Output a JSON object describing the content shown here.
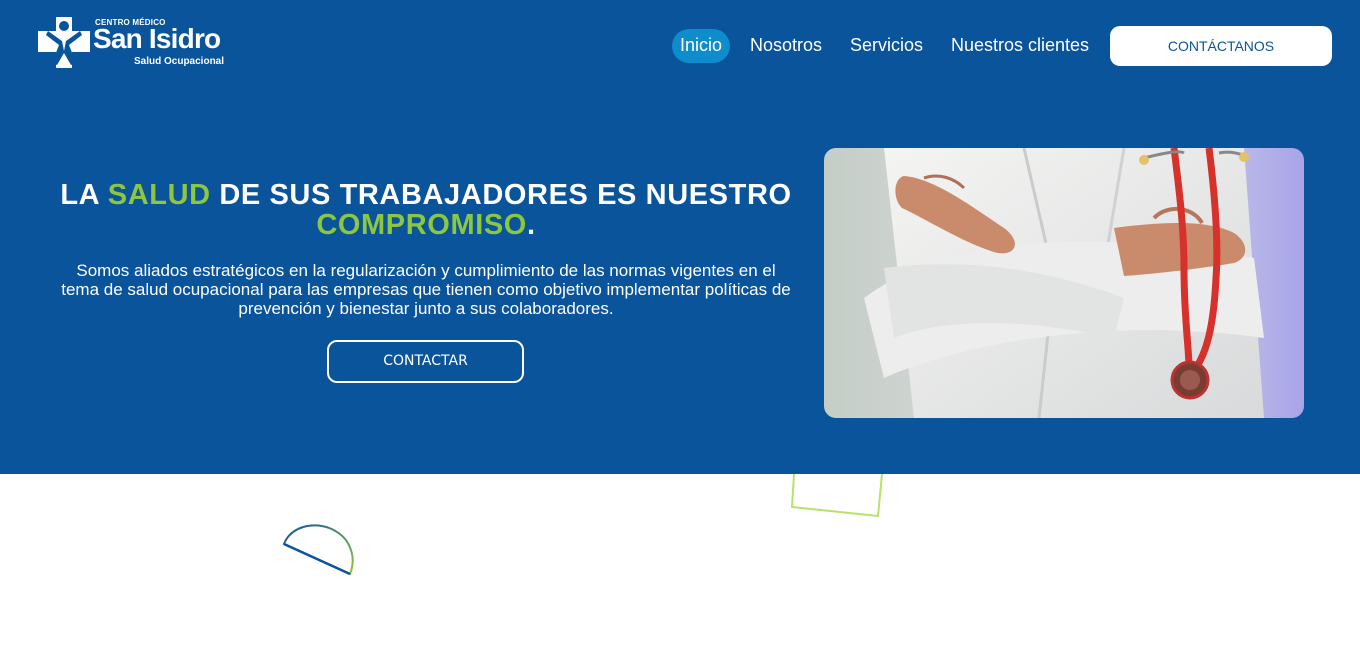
{
  "brand": {
    "top_line": "CENTRO MÉDICO",
    "name": "San Isidro",
    "tagline": "Salud Ocupacional",
    "logo_icon": "medical-cross-person-logo"
  },
  "nav": {
    "items": [
      {
        "label": "Inicio",
        "active": true
      },
      {
        "label": "Nosotros",
        "active": false
      },
      {
        "label": "Servicios",
        "active": false
      },
      {
        "label": "Nuestros clientes",
        "active": false
      }
    ],
    "cta_label": "CONTÁCTANOS"
  },
  "hero": {
    "headline": {
      "p1": "LA ",
      "h1": "SALUD",
      "p2": " DE SUS TRABAJADORES ES NUESTRO ",
      "h2": "COMPROMISO",
      "p3": "."
    },
    "description": "Somos aliados estratégicos en la regularización y cumplimiento de las normas vigentes en el tema de salud ocupacional para las empresas que tienen como objetivo implementar políticas de prevención y bienestar junto a sus colaboradores.",
    "button_label": "CONTACTAR",
    "image": "doctor-with-stethoscope-photo"
  },
  "colors": {
    "primary": "#0a549b",
    "accent_green": "#8dc63f",
    "nav_active": "#0f8ccb",
    "text_light": "#ffffff"
  }
}
